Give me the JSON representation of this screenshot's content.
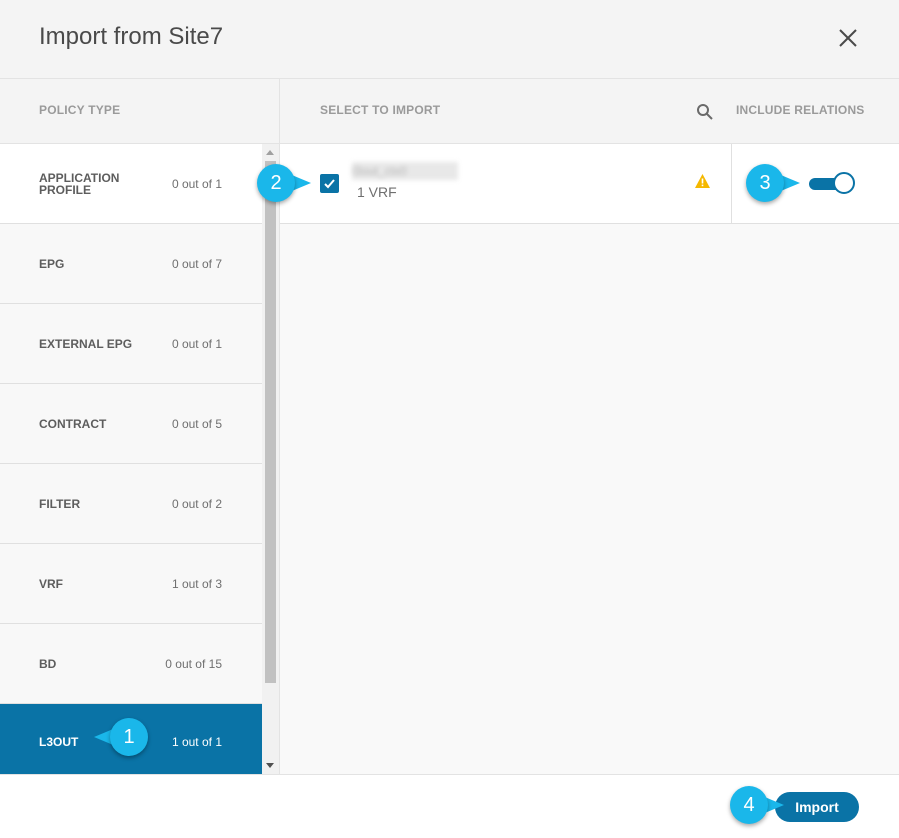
{
  "dialog": {
    "title": "Import from Site7",
    "close_icon": "close-icon"
  },
  "columns": {
    "policy_type": "POLICY TYPE",
    "select_to_import": "SELECT TO IMPORT",
    "include_relations": "INCLUDE RELATIONS",
    "search_icon": "search-icon"
  },
  "policy_types": [
    {
      "name": "APPLICATION PROFILE",
      "count": "0 out of 1"
    },
    {
      "name": "EPG",
      "count": "0 out of 7"
    },
    {
      "name": "EXTERNAL EPG",
      "count": "0 out of 1"
    },
    {
      "name": "CONTRACT",
      "count": "0 out of 5"
    },
    {
      "name": "FILTER",
      "count": "0 out of 2"
    },
    {
      "name": "VRF",
      "count": "1 out of 3"
    },
    {
      "name": "BD",
      "count": "0 out of 15"
    },
    {
      "name": "L3OUT",
      "count": "1 out of 1",
      "selected": true
    }
  ],
  "import_items": [
    {
      "name": "l3out_ctx0",
      "detail": "1 VRF",
      "checked": true,
      "warning_icon": "warning-icon",
      "include_relations": true
    }
  ],
  "footer": {
    "import_label": "Import"
  },
  "callouts": [
    "1",
    "2",
    "3",
    "4"
  ],
  "colors": {
    "accent": "#0a73a6",
    "callout": "#1ab7ea",
    "warning": "#f5b800"
  }
}
